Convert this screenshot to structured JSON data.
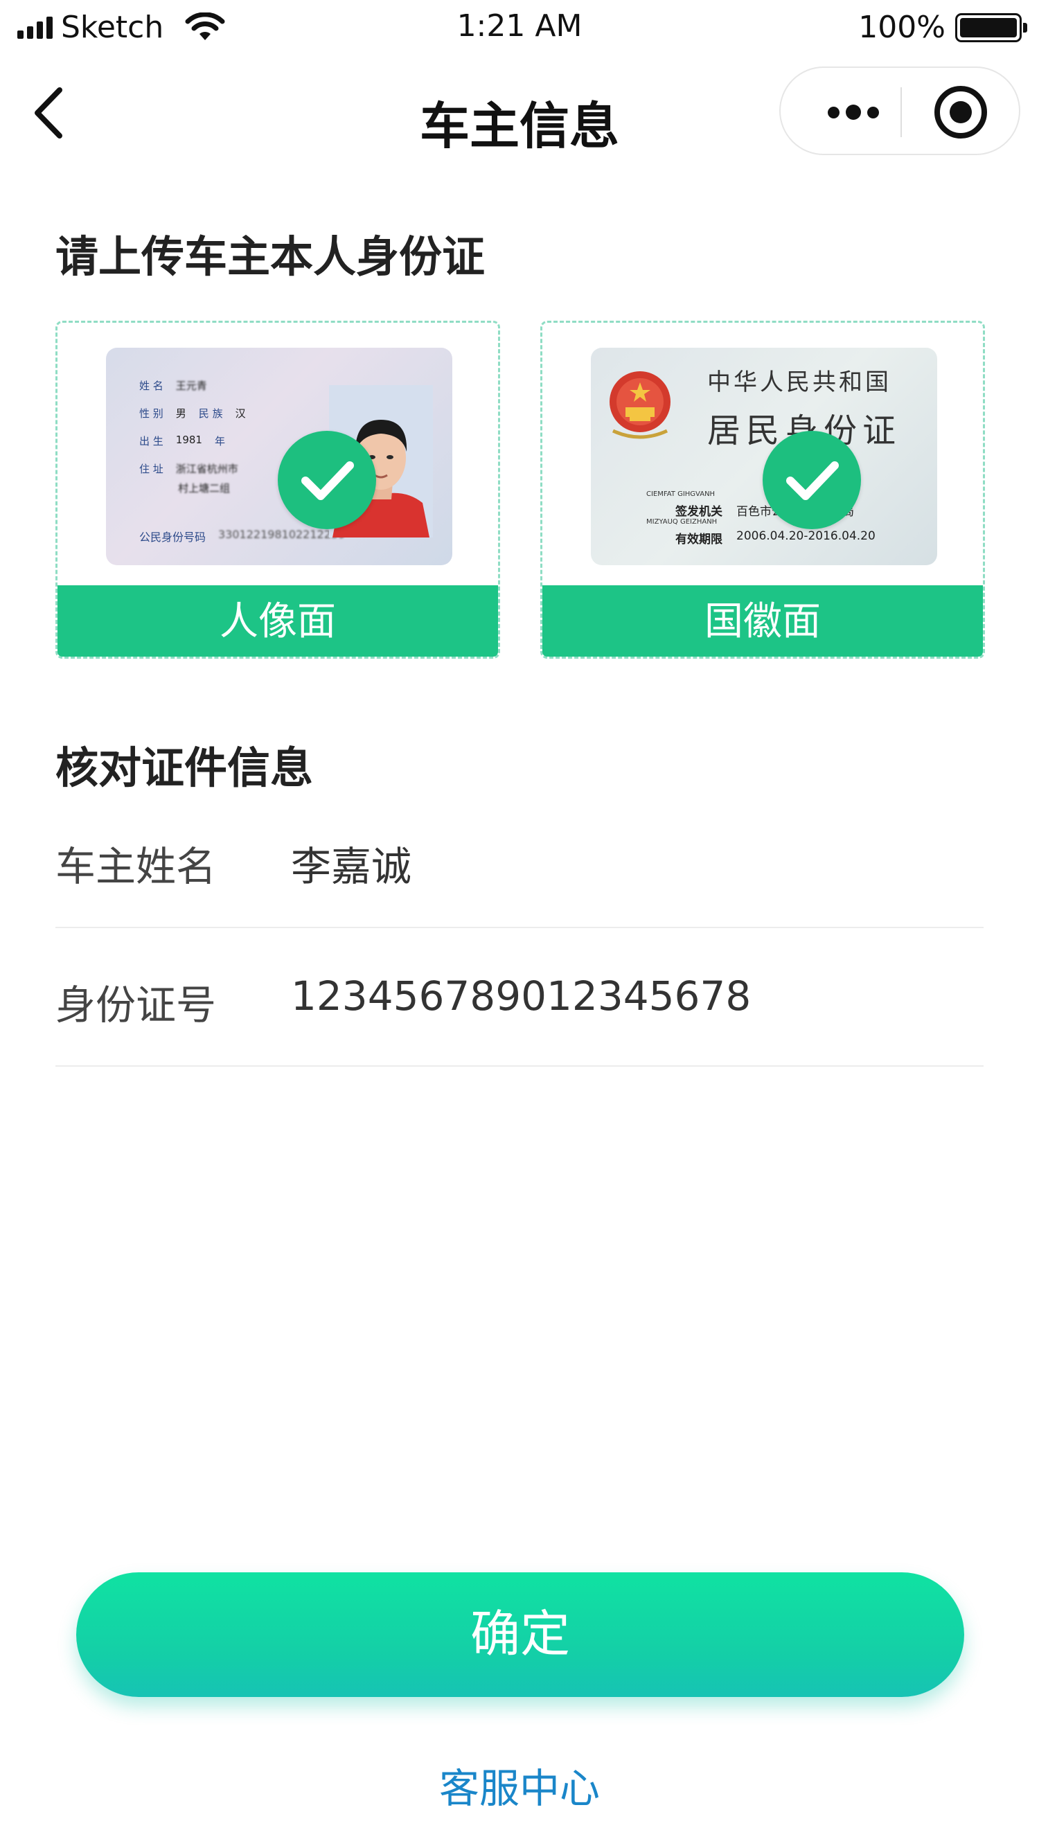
{
  "status_bar": {
    "carrier": "Sketch",
    "time": "1:21 AM",
    "battery": "100%"
  },
  "nav": {
    "title": "车主信息",
    "back_icon": "chevron-left-icon",
    "more_icon": "more-dots-icon",
    "close_icon": "target-close-icon"
  },
  "upload": {
    "heading": "请上传车主本人身份证",
    "cards": [
      {
        "label": "人像面",
        "status_icon": "check-icon",
        "id_front": {
          "name_label": "姓 名",
          "name_value": "王元青",
          "sex_label": "性 别",
          "sex_value": "男",
          "ethnic_label": "民 族",
          "ethnic_value": "汉",
          "birth_label": "出 生",
          "birth_value": "1981",
          "birth_unit": "年",
          "address_label": "住 址",
          "address_line1": "浙江省杭州市",
          "address_line2": "村上塘二组",
          "number_label": "公民身份号码",
          "number_value": "330122198102212239"
        }
      },
      {
        "label": "国徽面",
        "status_icon": "check-icon",
        "id_back": {
          "country": "中华人民共和国",
          "doc_title": "居民身份证",
          "authority_pinyin": "CIEMFAT GIHGVANH",
          "authority_label": "签发机关",
          "authority_value": "百色市公安局右江分局",
          "validity_pinyin": "MIZYAUQ GEIZHANH",
          "validity_label": "有效期限",
          "validity_value": "2006.04.20-2016.04.20"
        }
      }
    ]
  },
  "verify": {
    "heading": "核对证件信息",
    "rows": [
      {
        "label": "车主姓名",
        "value": "李嘉诚"
      },
      {
        "label": "身份证号",
        "value": "123456789012345678"
      }
    ]
  },
  "actions": {
    "confirm_label": "确定",
    "service_label": "客服中心"
  },
  "colors": {
    "accent_green": "#1dc486",
    "button_gradient_top": "#10e2a2",
    "button_gradient_bottom": "#16c3b4",
    "link_blue": "#1a86c9"
  }
}
